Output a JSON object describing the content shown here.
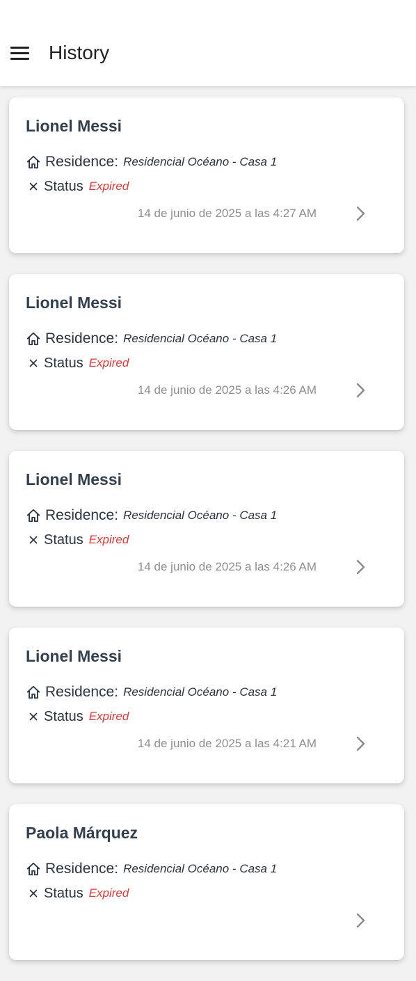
{
  "appbar": {
    "title": "History",
    "menu_icon": "hamburger-menu-icon"
  },
  "colors": {
    "name": "#323f4f",
    "status_expired": "#e53935",
    "date": "#8e8e8e",
    "background": "#f2f2f2"
  },
  "history": [
    {
      "name": "Lionel Messi",
      "residence_label": "Residence:",
      "residence": "Residencial Océano - Casa 1",
      "status_label": "Status",
      "status": "Expired",
      "date": "14 de junio de 2025 a las 4:27 AM"
    },
    {
      "name": "Lionel Messi",
      "residence_label": "Residence:",
      "residence": "Residencial Océano - Casa 1",
      "status_label": "Status",
      "status": "Expired",
      "date": "14 de junio de 2025 a las 4:26 AM"
    },
    {
      "name": "Lionel Messi",
      "residence_label": "Residence:",
      "residence": "Residencial Océano - Casa 1",
      "status_label": "Status",
      "status": "Expired",
      "date": "14 de junio de 2025 a las 4:26 AM"
    },
    {
      "name": "Lionel Messi",
      "residence_label": "Residence:",
      "residence": "Residencial Océano - Casa 1",
      "status_label": "Status",
      "status": "Expired",
      "date": "14 de junio de 2025 a las 4:21 AM"
    },
    {
      "name": "Paola Márquez",
      "residence_label": "Residence:",
      "residence": "Residencial Océano - Casa 1",
      "status_label": "Status",
      "status": "Expired",
      "date": ""
    }
  ]
}
